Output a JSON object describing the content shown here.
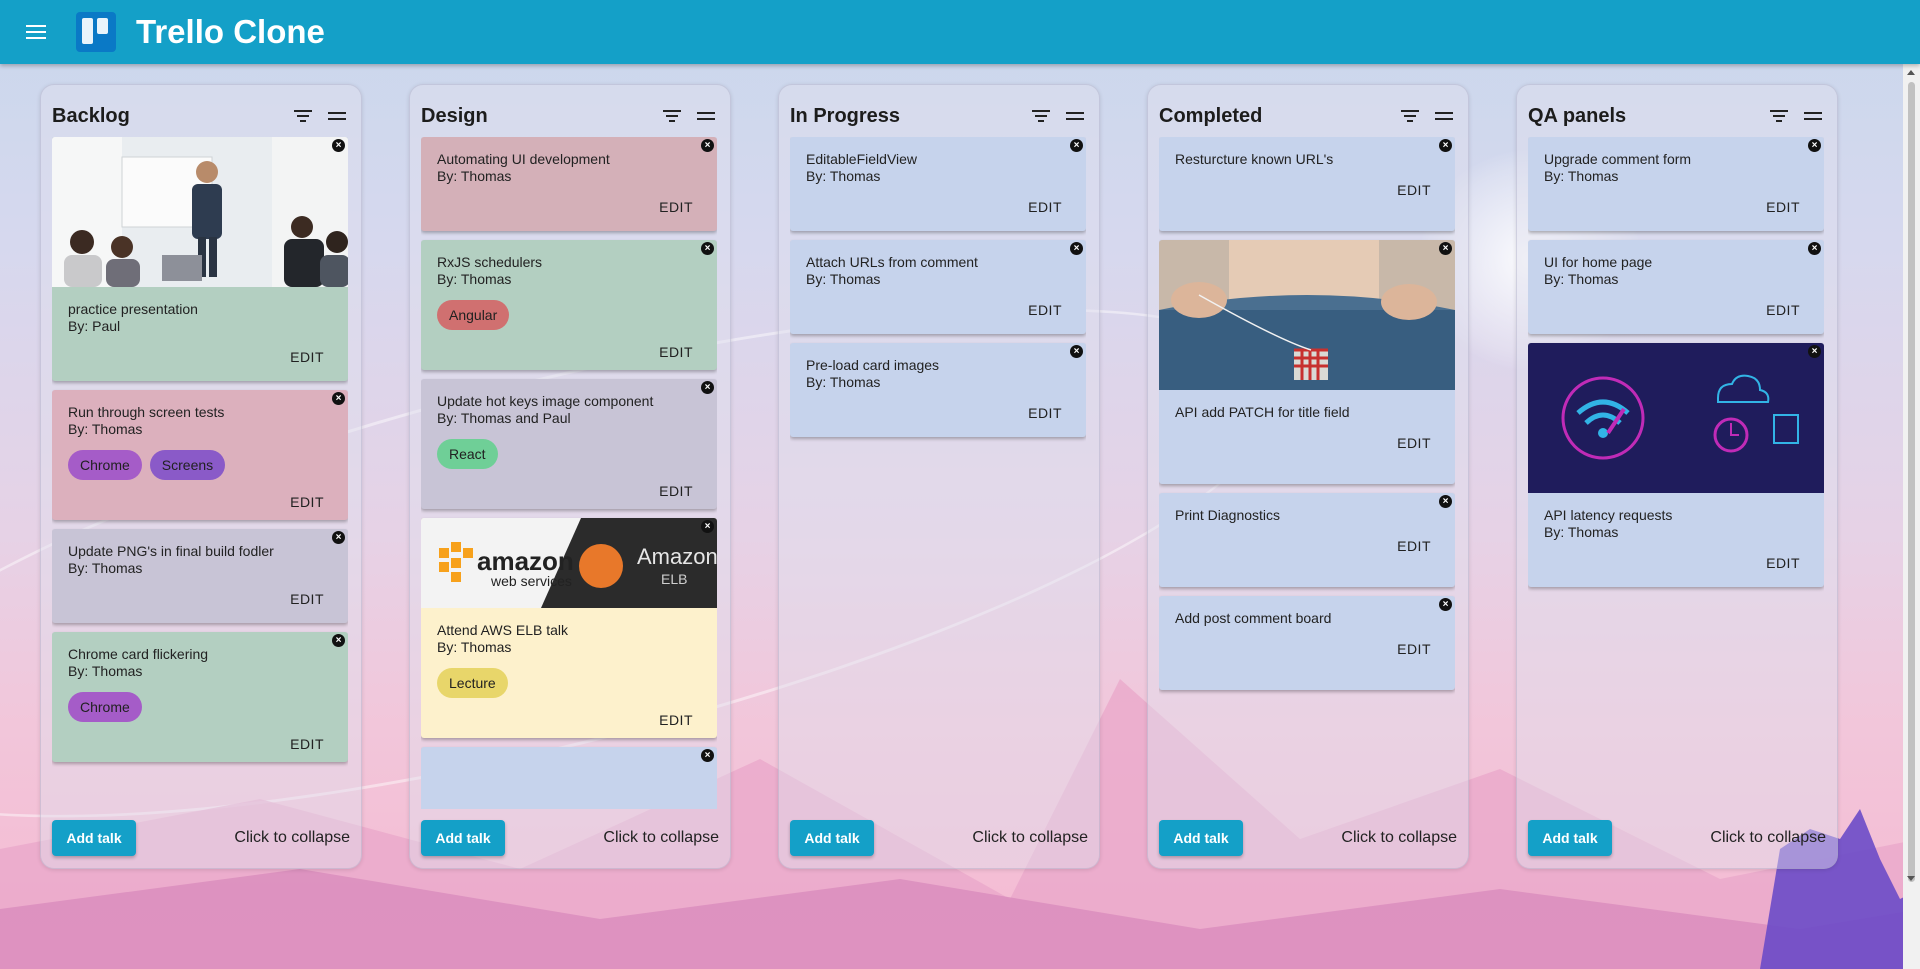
{
  "app": {
    "title": "Trello Clone"
  },
  "columns": [
    {
      "title": "Backlog",
      "cards": [
        {
          "title": "practice presentation",
          "author": "By: Paul",
          "bg": "#b3cfc1",
          "image": "meeting",
          "tags": [],
          "edit": "EDIT"
        },
        {
          "title": "Run through screen tests",
          "author": "By: Thomas",
          "bg": "#dcb0bd",
          "tags": [
            {
              "label": "Chrome",
              "bg": "#a55cc8"
            },
            {
              "label": "Screens",
              "bg": "#8a5ac8"
            }
          ],
          "edit": "EDIT"
        },
        {
          "title": "Update PNG's in final build fodler",
          "author": "By: Thomas",
          "bg": "#c8c4d6",
          "tags": [],
          "edit": "EDIT"
        },
        {
          "title": "Chrome card flickering",
          "author": "By: Thomas",
          "bg": "#b3cfc1",
          "tags": [
            {
              "label": "Chrome",
              "bg": "#a55cc8"
            }
          ],
          "edit": "EDIT"
        }
      ],
      "add_label": "Add talk",
      "collapse_label": "Click to collapse"
    },
    {
      "title": "Design",
      "cards": [
        {
          "title": "Automating UI development",
          "author": "By: Thomas",
          "bg": "#d4b0b8",
          "tags": [],
          "edit": "EDIT"
        },
        {
          "title": "RxJS schedulers",
          "author": "By: Thomas",
          "bg": "#b3cfc1",
          "tags": [
            {
              "label": "Angular",
              "bg": "#d07070"
            }
          ],
          "edit": "EDIT"
        },
        {
          "title": "Update hot keys image component",
          "author": "By: Thomas and Paul",
          "bg": "#c8c4d6",
          "tags": [
            {
              "label": "React",
              "bg": "#6fcf97"
            }
          ],
          "edit": "EDIT"
        },
        {
          "title": "Attend AWS ELB talk",
          "author": "By: Thomas",
          "bg": "#fdf1cc",
          "image": "aws",
          "tags": [
            {
              "label": "Lecture",
              "bg": "#e8d66a"
            }
          ],
          "edit": "EDIT"
        },
        {
          "title": "",
          "author": "",
          "bg": "#c6d3ec",
          "tags": [],
          "edit": ""
        }
      ],
      "add_label": "Add talk",
      "collapse_label": "Click to collapse"
    },
    {
      "title": "In Progress",
      "cards": [
        {
          "title": "EditableFieldView",
          "author": "By: Thomas",
          "bg": "#c6d3ec",
          "tags": [],
          "edit": "EDIT"
        },
        {
          "title": "Attach URLs from comment",
          "author": "By: Thomas",
          "bg": "#c6d3ec",
          "tags": [],
          "edit": "EDIT"
        },
        {
          "title": "Pre-load card images",
          "author": "By: Thomas",
          "bg": "#c6d3ec",
          "tags": [],
          "edit": "EDIT"
        }
      ],
      "add_label": "Add talk",
      "collapse_label": "Click to collapse"
    },
    {
      "title": "Completed",
      "cards": [
        {
          "title": "Resturcture known URL's",
          "author": "",
          "bg": "#c6d3ec",
          "tags": [],
          "edit": "EDIT"
        },
        {
          "title": "API add PATCH for title field",
          "author": "",
          "bg": "#c6d3ec",
          "image": "sewing",
          "tags": [],
          "edit": "EDIT"
        },
        {
          "title": "Print Diagnostics",
          "author": "",
          "bg": "#c6d3ec",
          "tags": [],
          "edit": "EDIT"
        },
        {
          "title": "Add post comment board",
          "author": "",
          "bg": "#c6d3ec",
          "tags": [],
          "edit": "EDIT"
        }
      ],
      "add_label": "Add talk",
      "collapse_label": "Click to collapse"
    },
    {
      "title": "QA panels",
      "cards": [
        {
          "title": "Upgrade comment form",
          "author": "By: Thomas",
          "bg": "#c6d3ec",
          "tags": [],
          "edit": "EDIT"
        },
        {
          "title": "UI for home page",
          "author": "By: Thomas",
          "bg": "#c6d3ec",
          "tags": [],
          "edit": "EDIT"
        },
        {
          "title": "API latency requests",
          "author": "By: Thomas",
          "bg": "#c6d3ec",
          "image": "latency",
          "tags": [],
          "edit": "EDIT"
        }
      ],
      "add_label": "Add talk",
      "collapse_label": "Click to collapse"
    }
  ],
  "icons": {
    "menu": "menu-icon",
    "filter": "filter-icon",
    "drag": "drag-handle-icon",
    "close": "close-icon"
  },
  "colors": {
    "appbar": "#14a0c8",
    "add_button": "#14a0c8"
  }
}
